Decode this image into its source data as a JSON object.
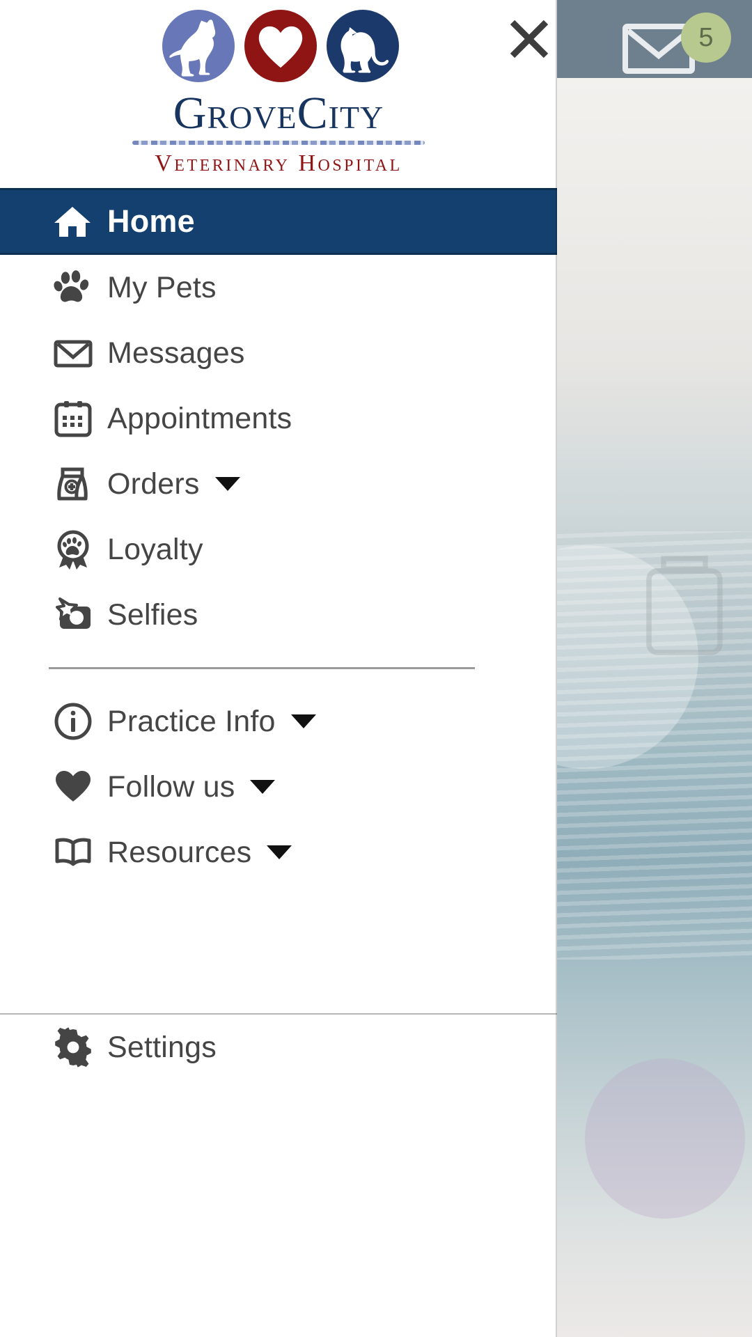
{
  "background": {
    "mail_icon": "mail-icon",
    "badge_count": "5",
    "badge_color": "#b7c98e",
    "header_color": "#6e7f8d"
  },
  "drawer": {
    "close_icon": "close-icon",
    "logo": {
      "dog_icon": "dog-silhouette-icon",
      "heart_icon": "heart-icon",
      "cat_icon": "cat-silhouette-icon",
      "wordmark": "GroveCity",
      "subtitle": "Veterinary Hospital",
      "wordmark_color": "#17355f",
      "subtitle_color": "#8f1515",
      "dog_circle_color": "#6877b8",
      "heart_circle_color": "#8f1515",
      "cat_circle_color": "#1b3a6b"
    },
    "active_color": "#13406e",
    "primary_items": [
      {
        "label": "Home",
        "icon": "home-icon",
        "active": true,
        "has_caret": false
      },
      {
        "label": "My Pets",
        "icon": "paw-icon",
        "active": false,
        "has_caret": false
      },
      {
        "label": "Messages",
        "icon": "envelope-icon",
        "active": false,
        "has_caret": false
      },
      {
        "label": "Appointments",
        "icon": "calendar-icon",
        "active": false,
        "has_caret": false
      },
      {
        "label": "Orders",
        "icon": "food-bag-icon",
        "active": false,
        "has_caret": true
      },
      {
        "label": "Loyalty",
        "icon": "award-paw-icon",
        "active": false,
        "has_caret": false
      },
      {
        "label": "Selfies",
        "icon": "camera-star-icon",
        "active": false,
        "has_caret": false
      }
    ],
    "secondary_items": [
      {
        "label": "Practice Info",
        "icon": "info-circle-icon",
        "has_caret": true
      },
      {
        "label": "Follow us",
        "icon": "heart-icon",
        "has_caret": true
      },
      {
        "label": "Resources",
        "icon": "open-book-icon",
        "has_caret": true
      }
    ],
    "footer_item": {
      "label": "Settings",
      "icon": "gear-icon",
      "has_caret": false
    }
  }
}
